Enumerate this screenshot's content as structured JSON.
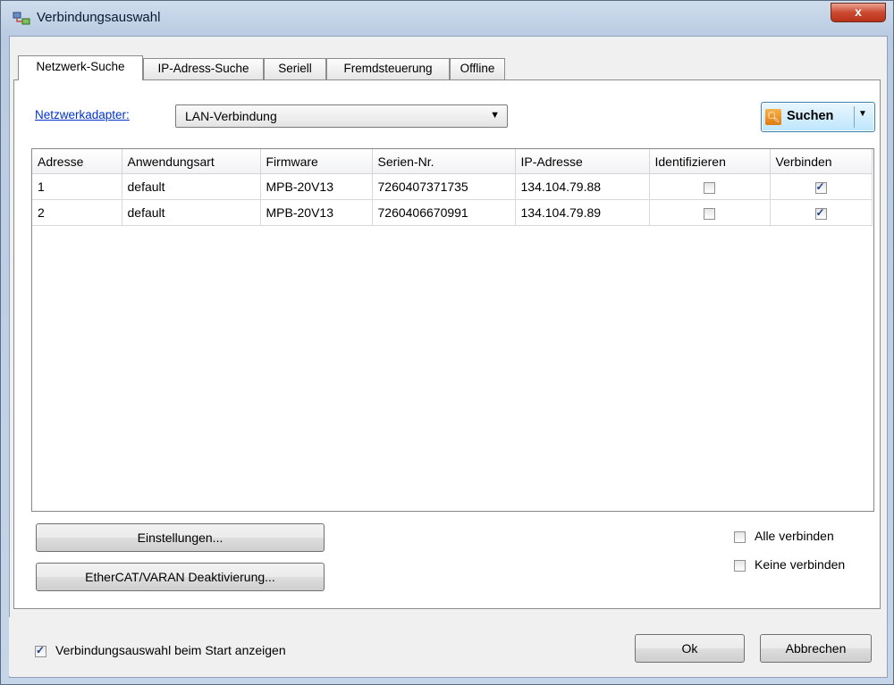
{
  "window": {
    "title": "Verbindungsauswahl",
    "close_glyph": "x",
    "icon": "network-app-icon"
  },
  "tabs": [
    {
      "label": "Netzwerk-Suche",
      "active": true
    },
    {
      "label": "IP-Adress-Suche",
      "active": false
    },
    {
      "label": "Seriell",
      "active": false
    },
    {
      "label": "Fremdsteuerung",
      "active": false
    },
    {
      "label": "Offline",
      "active": false
    }
  ],
  "adapter": {
    "link_label": "Netzwerkadapter:",
    "selected": "LAN-Verbindung"
  },
  "search": {
    "label": "Suchen",
    "icon": "search-icon"
  },
  "table": {
    "columns": [
      "Adresse",
      "Anwendungsart",
      "Firmware",
      "Serien-Nr.",
      "IP-Adresse",
      "Identifizieren",
      "Verbinden"
    ],
    "rows": [
      {
        "adresse": "1",
        "anwendungsart": "default",
        "firmware": "MPB-20V13",
        "serien": "7260407371735",
        "ip": "134.104.79.88",
        "identifizieren": false,
        "verbinden": true
      },
      {
        "adresse": "2",
        "anwendungsart": "default",
        "firmware": "MPB-20V13",
        "serien": "7260406670991",
        "ip": "134.104.79.89",
        "identifizieren": false,
        "verbinden": true
      }
    ]
  },
  "buttons": {
    "einstellungen": "Einstellungen...",
    "ethercat": "EtherCAT/VARAN Deaktivierung...",
    "ok": "Ok",
    "abbrechen": "Abbrechen"
  },
  "options": {
    "alle_verbinden": {
      "label": "Alle verbinden",
      "checked": false
    },
    "keine_verbinden": {
      "label": "Keine verbinden",
      "checked": false
    },
    "show_on_start": {
      "label": "Verbindungsauswahl beim Start anzeigen",
      "checked": true
    }
  },
  "colors": {
    "link": "#0033cc",
    "accent_button": "#bee6fd",
    "close": "#cc4a2f"
  }
}
